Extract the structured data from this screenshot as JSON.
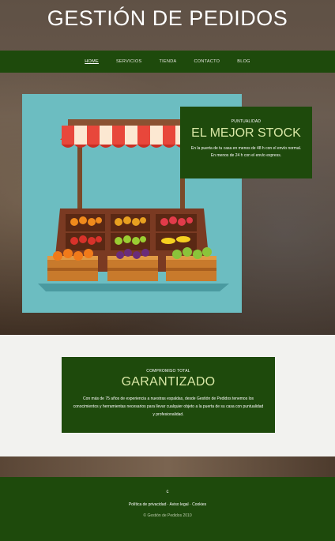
{
  "site": {
    "title": "GESTIÓN DE PEDIDOS"
  },
  "nav": {
    "items": [
      {
        "label": "HOME"
      },
      {
        "label": "SERVICIOS"
      },
      {
        "label": "TIENDA"
      },
      {
        "label": "CONTACTO"
      },
      {
        "label": "BLOG"
      }
    ]
  },
  "illustration": {
    "icon": "fruit-market-stall"
  },
  "stock_card": {
    "eyebrow": "PUNTUALIDAD",
    "heading": "EL MEJOR STOCK",
    "body": "En la puerta de tu casa en menos de 48 h con el envío normal. En menos de 24 h con el envío express."
  },
  "commitment_card": {
    "eyebrow": "COMPROMISO TOTAL",
    "heading": "GARANTIZADO",
    "body": "Con más de 75 años de experiencia a nuestras espaldas, desde Gestión de Pedidos tenemos los conocimientos y herramientas necesarios para llevar cualquier objeto a la puerta de su casa con puntualidad y profesionalidad."
  },
  "footer": {
    "icon_glyph": "c",
    "links": [
      "Política de privacidad",
      "Aviso legal",
      "Cookies"
    ],
    "separator": " · ",
    "copyright": "© Gestión de Pedidos 2010"
  },
  "colors": {
    "brand_green": "#1e4a0c",
    "accent_lime": "#d9e8a6",
    "teal": "#6cbdc1"
  }
}
